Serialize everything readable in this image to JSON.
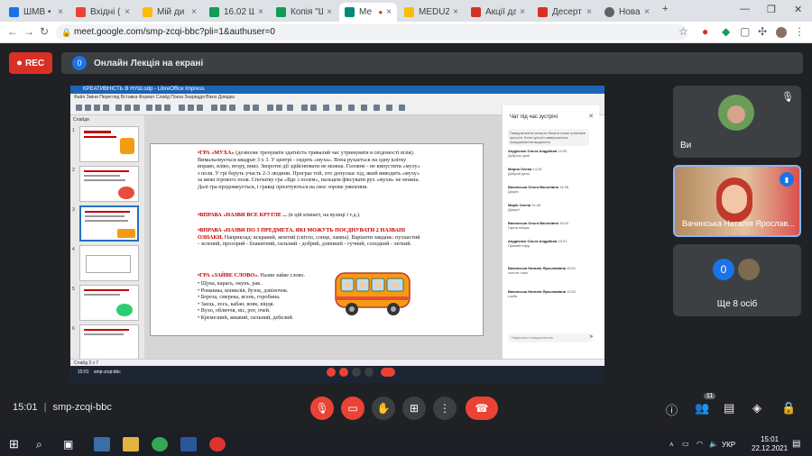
{
  "browser": {
    "tabs": [
      {
        "label": "ШМВ •",
        "color": "#1a73e8"
      },
      {
        "label": "Вхідні (1",
        "color": "#ea4335"
      },
      {
        "label": "Мій ди",
        "color": "#fbbc04"
      },
      {
        "label": "16.02 Ш",
        "color": "#0f9d58"
      },
      {
        "label": "Копія \"Ш",
        "color": "#0f9d58"
      },
      {
        "label": "Ме",
        "color": "#00897b"
      },
      {
        "label": "MEDUZA",
        "color": "#fbbc04"
      },
      {
        "label": "Акції да",
        "color": "#d93025"
      },
      {
        "label": "Десерт",
        "color": "#d93025"
      },
      {
        "label": "Нова",
        "color": "#5f6368"
      }
    ],
    "url": "meet.google.com/smp-zcqi-bbc?pli=1&authuser=0"
  },
  "meet": {
    "rec_label": "REC",
    "presenter_count": "0",
    "presenting_title": "Онлайн Лекція на екрані",
    "meeting_time": "15:01",
    "meeting_code": "smp-zcqi-bbc",
    "people_badge": "11",
    "participants": [
      {
        "name": "Ви"
      },
      {
        "name": "Вачинська Наталія Ярослав..."
      },
      {
        "name": "Ще 8 осіб",
        "count": "0"
      }
    ]
  },
  "shared_screen": {
    "app_title": "КРЕАТИВНІСТЬ В НУШ.odp - LibreOffice Impress",
    "menu": "Файл  Зміни  Перегляд  Вставка  Формат  Слайд  Показ  Знаряддя  Вікно  Довідка",
    "slides_label": "Слайди",
    "slide_numbers": [
      "1",
      "2",
      "3",
      "4",
      "5",
      "6"
    ],
    "status_left": "Слайд 3 з 7",
    "status_time": "15:01",
    "status_code": "smp-zcqi-bbc",
    "slide_text": [
      {
        "bold": "•ГРА «МУХА»",
        "text": " (дозволяє тренувати здатність тривалий час утримувати в свідомості візія). Вимальовується квадрат 3 х 3. У центрі - сидить «муха». Вона рухається на одну клітку вправо, вліво, вгору, вниз. Зворотні дії здійснювати не можна. Головне - не випустити «муху» з поля. У грі беруть участь 2-3 людини. Програє той, хто допускає хід, який виводить «муху» за межі ігрового поля. Спочатку гра «Вдє з полем», пальцем фіксувати рух «мухи» не можна. Далі гра продовжується, і гравці орієнтуються на своє зорове уявлення."
      },
      {
        "bold": "•ВПРАВА «НАЗВИ ВСЕ КРУГЛЕ ...",
        "text": " (в цій кімнаті, на вулиці і т.д.)."
      },
      {
        "bold": "•ВПРАВА «НАЗВИ ПО 3 ПРЕДМЕТА, ЯКІ МОЖУТЬ ПОЄДНУВАТИ 2 НАЗВАНІ ОЗНАКИ.",
        "text": " Наприклад: яскравий, жовтий (світло, сонце, лампа). Варіанти завдань: пухнастий - зелений, прозорий - блакитний, сильний - добрий, дзвінкий - гучний, солодкий - легкий."
      },
      {
        "bold": "•ГРА «ЗАЙВЕ СЛОВО».",
        "text": " Назви зайве слово."
      }
    ],
    "word_list": [
      "• Щука, карась, окунь, рак.",
      "• Ромашка, конвалія, бузок, дзвіночок.",
      "• Береза, смерека, ясень, горобина.",
      "• Заєць, лось, кабан, вовк, віцця.",
      "• Вухо, обличчя, ніс, рот, очей.",
      "• Кремезний, жвавий, сильний, дебелий."
    ],
    "chat_title": "Чат під час зустрічі",
    "chat_notice": "Повідомлення можуть бачити лише учасники зустрічі. Коли зустріч завершиться, повідомлення видалено.",
    "chat_messages": [
      {
        "name": "Андрієнко Ольга Андріївна",
        "time": "14:30",
        "text": "Доброго дня!"
      },
      {
        "name": "Мирна Олена",
        "time": "14:35",
        "text": "Добрий день"
      },
      {
        "name": "Вачинська Ольга Василівна",
        "time": "14:38",
        "text": "Дякую"
      },
      {
        "name": "Марія Олена",
        "time": "14:46",
        "text": "Дякую!"
      },
      {
        "name": "Вачинська Ольга Василівна",
        "time": "15:00",
        "text": "Гарна лекція"
      },
      {
        "name": "Андрієнко Ольга Андріївна",
        "time": "15:01",
        "text": "Прямий ефір"
      },
      {
        "name": "Вачинська Наталія Ярославівна",
        "time": "15:01",
        "text": "золоте сало"
      },
      {
        "name": "Вачинська Наталія Ярославівна",
        "time": "15:02",
        "text": "горби"
      }
    ],
    "chat_input_placeholder": "Надіслати повідомлення"
  },
  "taskbar": {
    "language": "УКР",
    "time": "15:01",
    "date": "22.12.2021"
  }
}
